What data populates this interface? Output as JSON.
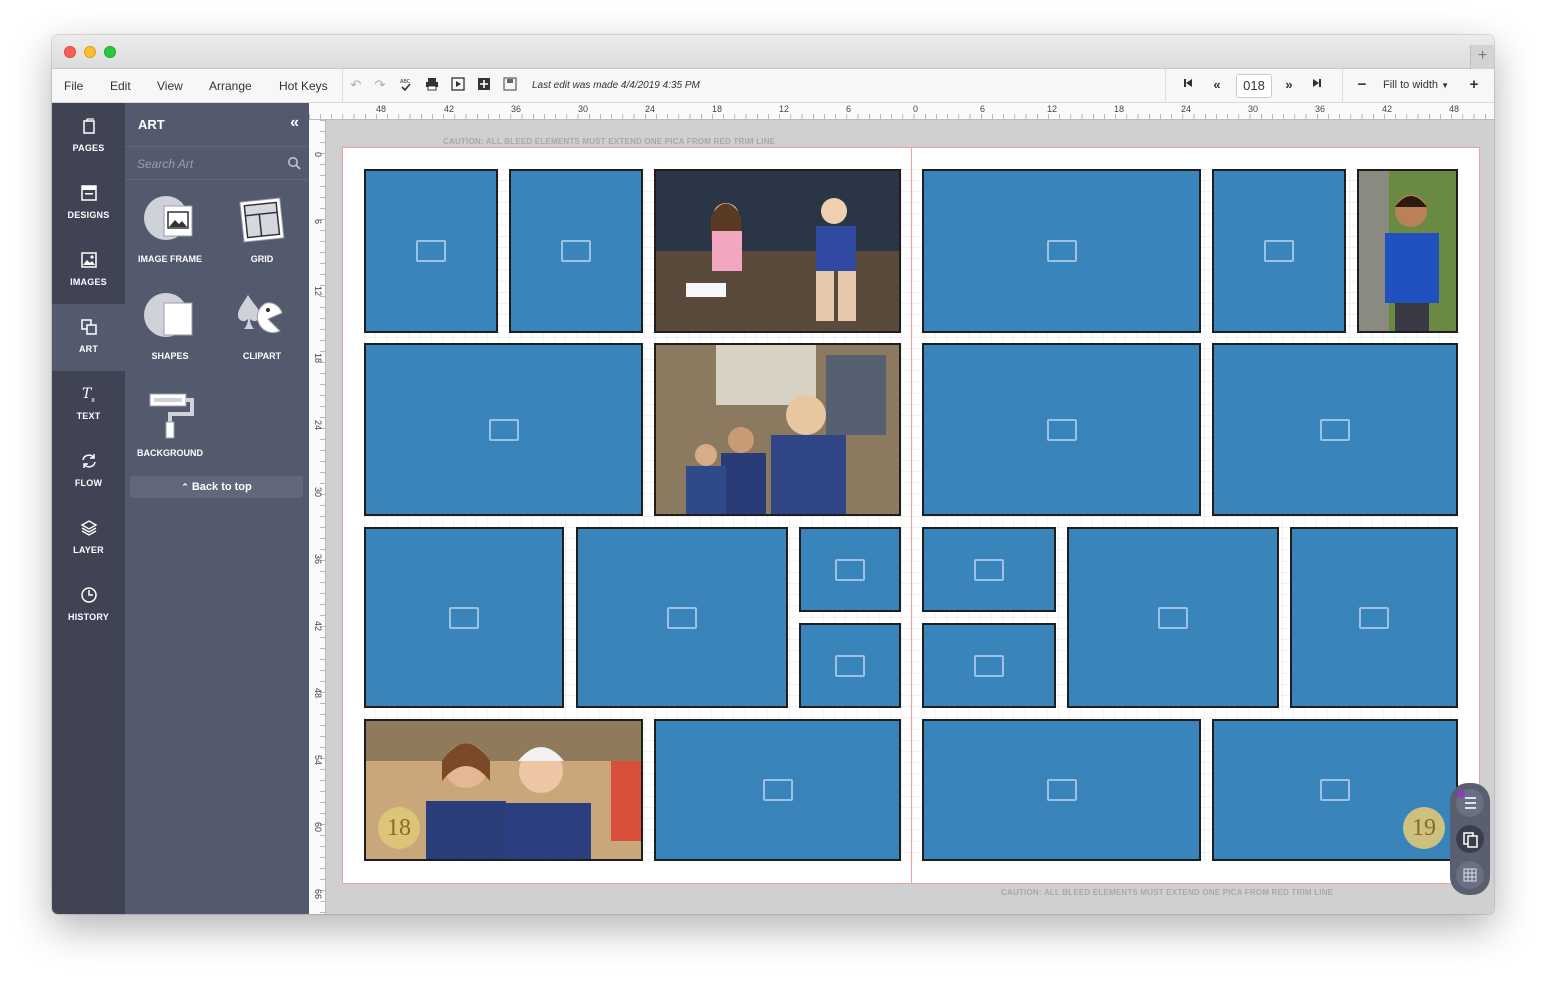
{
  "menu": {
    "file": "File",
    "edit": "Edit",
    "view": "View",
    "arrange": "Arrange",
    "hotkeys": "Hot Keys"
  },
  "toolbar": {
    "last_edit": "Last edit was made 4/4/2019 4:35 PM",
    "page_number": "018",
    "zoom": "Fill to width"
  },
  "rail": [
    {
      "label": "PAGES",
      "icon": "pages-icon"
    },
    {
      "label": "DESIGNS",
      "icon": "designs-icon"
    },
    {
      "label": "IMAGES",
      "icon": "images-icon"
    },
    {
      "label": "ART",
      "icon": "art-icon"
    },
    {
      "label": "TEXT",
      "icon": "text-icon"
    },
    {
      "label": "FLOW",
      "icon": "flow-icon"
    },
    {
      "label": "LAYER",
      "icon": "layer-icon"
    },
    {
      "label": "HISTORY",
      "icon": "history-icon"
    }
  ],
  "panel": {
    "title": "ART",
    "search_placeholder": "Search Art",
    "tiles": [
      {
        "label": "IMAGE FRAME",
        "icon": "image-frame-icon"
      },
      {
        "label": "GRID",
        "icon": "grid-icon"
      },
      {
        "label": "SHAPES",
        "icon": "shapes-icon"
      },
      {
        "label": "CLIPART",
        "icon": "clipart-icon"
      },
      {
        "label": "BACKGROUND",
        "icon": "background-roller-icon"
      }
    ],
    "back_to_top": "Back to top"
  },
  "ruler": {
    "top": [
      "48",
      "42",
      "36",
      "30",
      "24",
      "18",
      "12",
      "6",
      "0",
      "6",
      "12",
      "18",
      "24",
      "30",
      "36",
      "42",
      "48"
    ],
    "left": [
      "0",
      "6",
      "12",
      "18",
      "24",
      "30",
      "36",
      "42",
      "48",
      "54",
      "60",
      "66"
    ]
  },
  "canvas": {
    "caution": "CAUTION: ALL BLEED ELEMENTS MUST EXTEND ONE PICA FROM RED TRIM LINE",
    "left_page_number": "18",
    "right_page_number": "19"
  },
  "colors": {
    "slot": "#3a84bc",
    "rail": "#3f4354",
    "panel": "#545a6d"
  }
}
